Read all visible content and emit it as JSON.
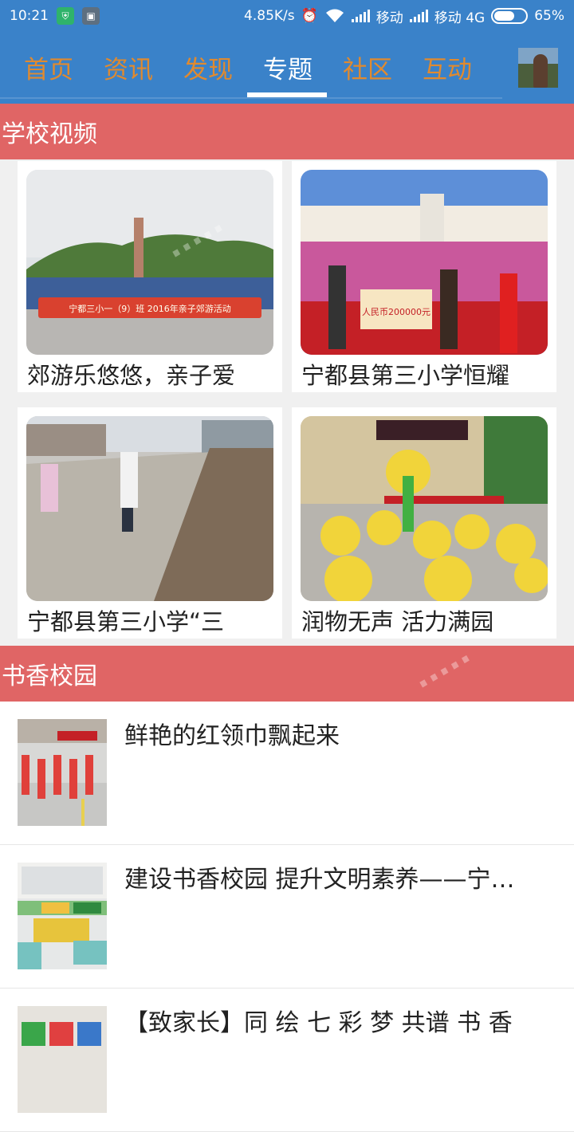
{
  "status_bar": {
    "time": "10:21",
    "speed": "4.85K/s",
    "carrier1": "移动",
    "carrier2": "移动 4G",
    "battery": "65%",
    "battery_level": 0.65,
    "icons": [
      "shield-icon",
      "sim-icon",
      "alarm-icon",
      "wifi-icon",
      "signal-icon",
      "battery-icon"
    ]
  },
  "nav": {
    "tabs": [
      {
        "label": "首页"
      },
      {
        "label": "资讯"
      },
      {
        "label": "发现"
      },
      {
        "label": "专题",
        "active": true
      },
      {
        "label": "社区"
      },
      {
        "label": "互动"
      }
    ]
  },
  "sections": {
    "videos_title": "学校视频",
    "reading_title": "书香校园"
  },
  "video_cards": [
    {
      "caption": "郊游乐悠悠，亲子爱",
      "banner": "宁都三小一（9）班  2016年亲子郊游活动"
    },
    {
      "caption": "宁都县第三小学恒耀",
      "banner": "人民币200000元"
    },
    {
      "caption": "宁都县第三小学“三"
    },
    {
      "caption": "润物无声 活力满园"
    }
  ],
  "articles": [
    {
      "title": "鲜艳的红领巾飘起来"
    },
    {
      "title": "建设书香校园  提升文明素养——宁…"
    },
    {
      "title": "【致家长】同 绘 七 彩 梦  共谱 书 香"
    }
  ],
  "colors": {
    "header_blue": "#3a82c9",
    "tab_orange": "#e08a2f",
    "section_red": "#e06565"
  }
}
